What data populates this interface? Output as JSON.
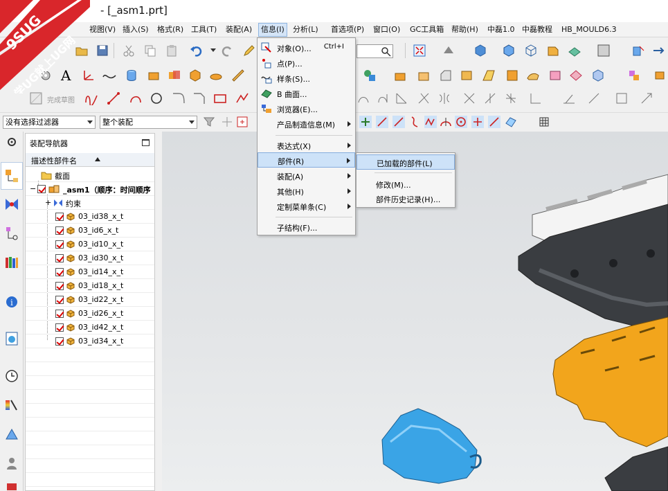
{
  "window": {
    "title": "- [_asm1.prt]"
  },
  "logo": {
    "top_text": "9SUG",
    "bottom_text": "学UG就上UG网"
  },
  "menubar": {
    "items": [
      "视图(V)",
      "插入(S)",
      "格式(R)",
      "工具(T)",
      "装配(A)",
      "信息(I)",
      "分析(L)",
      "首选项(P)",
      "窗口(O)",
      "GC工具箱",
      "帮助(H)",
      "中磊1.0",
      "中磊教程",
      "HB_MOULD6.3"
    ],
    "active": "信息(I)"
  },
  "toolbar": {
    "sketch_label": "完成草图",
    "filter_select": "没有选择过滤器",
    "assembly_select": "整个装配"
  },
  "navigator": {
    "title": "装配导航器",
    "column_header": "描述性部件名",
    "section_label": "截面",
    "root_label": "_asm1（顺序：时间顺序",
    "constraints_label": "约束",
    "parts": [
      "03_id38_x_t",
      "03_id6_x_t",
      "03_id10_x_t",
      "03_id30_x_t",
      "03_id14_x_t",
      "03_id18_x_t",
      "03_id22_x_t",
      "03_id26_x_t",
      "03_id42_x_t",
      "03_id34_x_t"
    ]
  },
  "info_menu": {
    "object_label": "对象(O)...",
    "object_shortcut": "Ctrl+I",
    "point_label": "点(P)...",
    "spline_label": "样条(S)...",
    "bsurface_label": "B 曲面...",
    "browser_label": "浏览器(E)...",
    "pmi_label": "产品制造信息(M)",
    "expression_label": "表达式(X)",
    "part_label": "部件(R)",
    "assembly_label": "装配(A)",
    "other_label": "其他(H)",
    "custom_menubar_label": "定制菜单条(C)",
    "substructure_label": "子结构(F)..."
  },
  "part_submenu": {
    "loaded_parts_label": "已加载的部件(L)",
    "modified_label": "修改(M)...",
    "part_history_label": "部件历史记录(H)..."
  },
  "colors": {
    "highlight": "#cde2f8",
    "highlight_border": "#84acdd",
    "part_orange": "#f2a51c",
    "part_blue": "#3aa4e6",
    "part_dark": "#3a3d41",
    "part_white": "#f4f4f4",
    "logo_red": "#d9262b"
  }
}
